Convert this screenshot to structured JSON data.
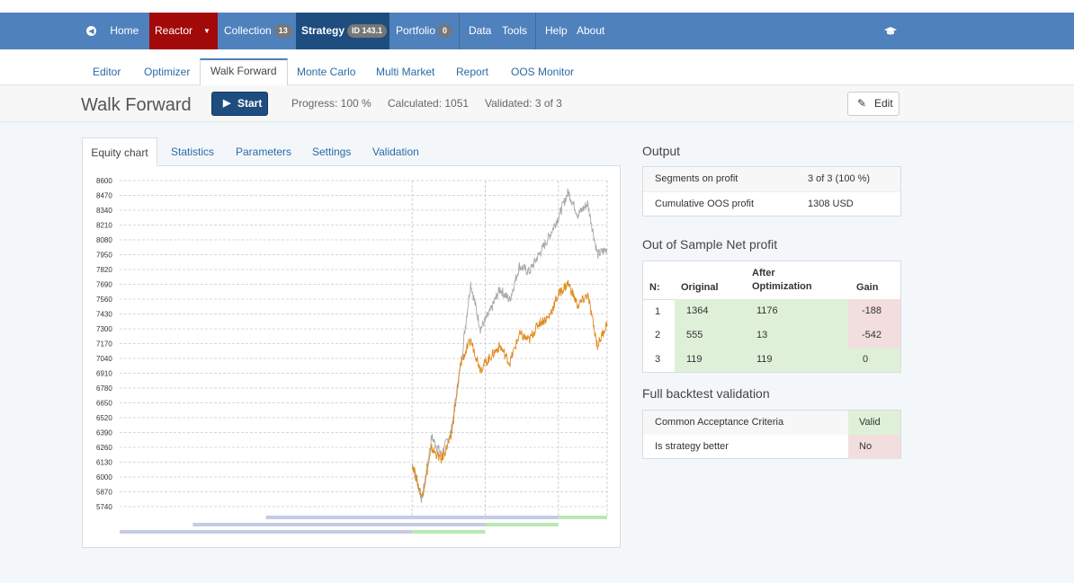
{
  "navbar": {
    "home": "Home",
    "reactor": "Reactor",
    "collection": "Collection",
    "collection_count": "13",
    "strategy": "Strategy",
    "strategy_id": "ID 143.1",
    "portfolio": "Portfolio",
    "portfolio_count": "0",
    "data": "Data",
    "tools": "Tools",
    "help": "Help",
    "about": "About"
  },
  "subnav": [
    "Editor",
    "Optimizer",
    "Walk Forward",
    "Monte Carlo",
    "Multi Market",
    "Report",
    "OOS Monitor"
  ],
  "toolbar": {
    "title": "Walk Forward",
    "start": "Start",
    "progress": "Progress: 100 %",
    "calculated": "Calculated: 1051",
    "validated": "Validated: 3 of 3",
    "edit": "Edit"
  },
  "panel_tabs": [
    "Equity chart",
    "Statistics",
    "Parameters",
    "Settings",
    "Validation"
  ],
  "output": {
    "title": "Output",
    "rows": [
      {
        "label": "Segments on profit",
        "value": "3 of 3 (100 %)"
      },
      {
        "label": "Cumulative OOS profit",
        "value": "1308 USD"
      }
    ]
  },
  "oos": {
    "title": "Out of Sample Net profit",
    "headers": {
      "n": "N:",
      "original": "Original",
      "after1": "After",
      "after2": "Optimization",
      "gain": "Gain"
    },
    "rows": [
      {
        "n": "1",
        "original": "1364",
        "after": "1176",
        "gain": "-188"
      },
      {
        "n": "2",
        "original": "555",
        "after": "13",
        "gain": "-542"
      },
      {
        "n": "3",
        "original": "119",
        "after": "119",
        "gain": "0"
      }
    ]
  },
  "validation": {
    "title": "Full backtest validation",
    "rows": [
      {
        "label": "Common Acceptance Criteria",
        "value": "Valid"
      },
      {
        "label": "Is strategy better",
        "value": "No"
      }
    ]
  },
  "chart_data": {
    "type": "line",
    "yticks": [
      8600,
      8470,
      8340,
      8210,
      8080,
      7950,
      7820,
      7690,
      7560,
      7430,
      7300,
      7170,
      7040,
      6910,
      6780,
      6650,
      6520,
      6390,
      6260,
      6130,
      6000,
      5870,
      5740
    ],
    "ylim": [
      5740,
      8600
    ],
    "series": [
      {
        "color": "#a8a8a8",
        "values": [
          6120,
          5800,
          6350,
          6200,
          6400,
          7000,
          7700,
          7300,
          7450,
          7650,
          7550,
          7850,
          7800,
          7950,
          8100,
          8280,
          8500,
          8300,
          8400,
          7950,
          8000
        ]
      },
      {
        "color": "#e08a1e",
        "values": [
          6120,
          5820,
          6250,
          6150,
          6350,
          7000,
          7200,
          6950,
          7050,
          7150,
          7000,
          7250,
          7200,
          7350,
          7400,
          7600,
          7700,
          7500,
          7600,
          7150,
          7350
        ]
      }
    ],
    "segments": [
      {
        "is_start": 0.0,
        "oos_start": 0.6,
        "oos_end": 0.75
      },
      {
        "is_start": 0.15,
        "oos_start": 0.75,
        "oos_end": 0.9
      },
      {
        "is_start": 0.3,
        "oos_start": 0.9,
        "oos_end": 1.0
      }
    ]
  },
  "colors": {
    "navbar": "#4f81bd",
    "reactor": "#a20a0a",
    "strategy": "#1e4d80",
    "green": "#dff0d8",
    "red": "#f2dede"
  }
}
